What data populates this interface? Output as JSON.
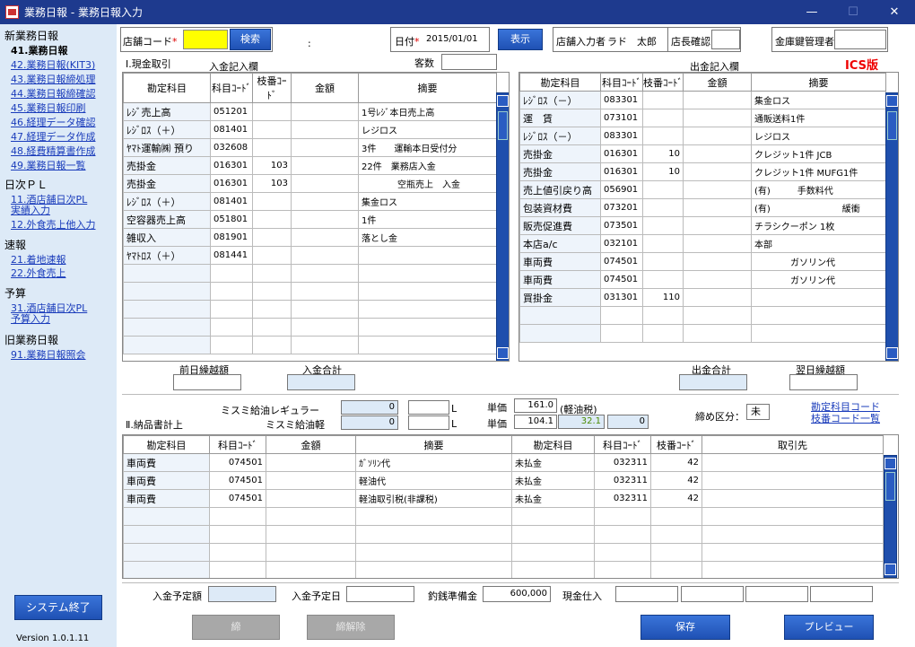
{
  "window": {
    "title": "業務日報 - 業務日報入力",
    "min": "—",
    "max": "☐",
    "close": "✕"
  },
  "sidebar": {
    "sec1": "新業務日報",
    "items1": [
      "41.業務日報",
      "42.業務日報(KIT3)",
      "43.業務日報締処理",
      "44.業務日報締確認",
      "45.業務日報印刷",
      "46.経理データ確認",
      "47.経理データ作成",
      "48.経費精算書作成",
      "49.業務日報一覧"
    ],
    "sec2": "日次ＰＬ",
    "items2": [
      [
        "11.酒店舗日次PL",
        "実績入力"
      ],
      [
        "12.外食売上他入力"
      ]
    ],
    "sec3": "速報",
    "items3": [
      "21.着地速報",
      "22.外食売上"
    ],
    "sec4": "予算",
    "items4": [
      [
        "31.酒店舗日次PL",
        "予算入力"
      ]
    ],
    "sec5": "旧業務日報",
    "items5": [
      "91.業務日報照会"
    ],
    "exit_button": "システム終了",
    "version": "Version  1.0.1.11"
  },
  "header": {
    "store_code_label": "店舗コード",
    "required_mark": "*",
    "store_code_value": "",
    "search_button": "検索",
    "colon": ":",
    "date_label": "日付",
    "date_value": "2015/01/01",
    "show_button": "表示",
    "store_input_label": "店舗入力者",
    "store_input_value": "ラド　太郎",
    "manager_confirm_label": "店長確認",
    "manager_confirm_value": "",
    "safe_key_label": "金庫鍵管理者",
    "safe_key_value": ""
  },
  "section1": {
    "title": "I.現金取引",
    "in_label": "入金記入欄",
    "customers_label": "客数",
    "customers_value": "",
    "out_label": "出金記入欄",
    "ics_label": "ICS版"
  },
  "in_table": {
    "headers": [
      "勘定科目",
      "科目ｺｰﾄﾞ",
      "枝番ｺｰﾄﾞ",
      "金額",
      "摘要"
    ],
    "rows": [
      [
        "ﾚｼﾞ売上高",
        "051201",
        "",
        "",
        "1号ﾚｼﾞ本日売上高"
      ],
      [
        "ﾚｼﾞﾛｽ（＋）",
        "081401",
        "",
        "",
        "レジロス"
      ],
      [
        "ﾔﾏﾄ運輸㈱ 預り",
        "032608",
        "",
        "",
        "3件　　運輸本日受付分"
      ],
      [
        "売掛金",
        "016301",
        "103",
        "",
        "22件　業務店入金"
      ],
      [
        "売掛金",
        "016301",
        "103",
        "",
        "　　　　空瓶売上　入金"
      ],
      [
        "ﾚｼﾞﾛｽ（＋）",
        "081401",
        "",
        "",
        "集金ロス"
      ],
      [
        "空容器売上高",
        "051801",
        "",
        "",
        "1件"
      ],
      [
        "雑収入",
        "081901",
        "",
        "",
        "落とし金"
      ],
      [
        "ﾔﾏﾄﾛｽ（＋）",
        "081441",
        "",
        "",
        ""
      ],
      [
        "",
        "",
        "",
        "",
        ""
      ],
      [
        "",
        "",
        "",
        "",
        ""
      ],
      [
        "",
        "",
        "",
        "",
        ""
      ],
      [
        "",
        "",
        "",
        "",
        ""
      ],
      [
        "",
        "",
        "",
        "",
        ""
      ]
    ]
  },
  "out_table": {
    "headers": [
      "勘定科目",
      "科目ｺｰﾄﾞ",
      "枝番ｺｰﾄﾞ",
      "金額",
      "摘要"
    ],
    "rows": [
      [
        "ﾚｼﾞﾛｽ（－）",
        "083301",
        "",
        "",
        "集金ロス"
      ],
      [
        "運　賃",
        "073101",
        "",
        "",
        "通販送料1件"
      ],
      [
        "ﾚｼﾞﾛｽ（－）",
        "083301",
        "",
        "",
        "レジロス"
      ],
      [
        "売掛金",
        "016301",
        "10",
        "",
        "クレジット1件  JCB"
      ],
      [
        "売掛金",
        "016301",
        "10",
        "",
        "クレジット1件  MUFG1件"
      ],
      [
        "売上値引戻り高",
        "056901",
        "",
        "",
        "(有)　　　手数料代"
      ],
      [
        "包装資材費",
        "073201",
        "",
        "",
        "(有)　　　　　　　　緩衝"
      ],
      [
        "販売促進費",
        "073501",
        "",
        "",
        "チラシクーポン  1枚"
      ],
      [
        "本店a/c",
        "032101",
        "",
        "",
        "本部"
      ],
      [
        "車両費",
        "074501",
        "",
        "",
        "　　　　ガソリン代"
      ],
      [
        "車両費",
        "074501",
        "",
        "",
        "　　　　ガソリン代"
      ],
      [
        "買掛金",
        "031301",
        "110",
        "",
        ""
      ],
      [
        "",
        "",
        "",
        "",
        ""
      ],
      [
        "",
        "",
        "",
        "",
        ""
      ]
    ]
  },
  "totals": {
    "prev_balance": "前日繰越額",
    "in_total": "入金合計",
    "out_total": "出金合計",
    "next_balance": "翌日繰越額"
  },
  "fuel": {
    "regular_label": "ミスミ給油レギュラー",
    "regular_value": "0",
    "light_label": "ミスミ給油軽",
    "light_value": "0",
    "unit_l": "L",
    "price_label": "単価",
    "regular_price": "161.0",
    "light_price": "104.1",
    "light_tax_label": "(軽油税)",
    "light_tax": "32.1",
    "extra_value": "0",
    "closing_label": "締め区分：",
    "closing_value": "未",
    "link1": "勘定科目コード",
    "link2": "枝番コード一覧"
  },
  "section2": {
    "title": "Ⅱ.納品書計上"
  },
  "delivery_table": {
    "headers": [
      "勘定科目",
      "科目ｺｰﾄﾞ",
      "金額",
      "摘要",
      "勘定科目",
      "科目ｺｰﾄﾞ",
      "枝番ｺｰﾄﾞ",
      "取引先"
    ],
    "rows": [
      [
        "車両費",
        "074501",
        "",
        "ｶﾞｿﾘﾝ代",
        "未払金",
        "032311",
        "42",
        ""
      ],
      [
        "車両費",
        "074501",
        "",
        "軽油代",
        "未払金",
        "032311",
        "42",
        ""
      ],
      [
        "車両費",
        "074501",
        "",
        "軽油取引税(非課税)",
        "未払金",
        "032311",
        "42",
        ""
      ],
      [
        "",
        "",
        "",
        "",
        "",
        "",
        "",
        ""
      ],
      [
        "",
        "",
        "",
        "",
        "",
        "",
        "",
        ""
      ],
      [
        "",
        "",
        "",
        "",
        "",
        "",
        "",
        ""
      ],
      [
        "",
        "",
        "",
        "",
        "",
        "",
        "",
        ""
      ]
    ]
  },
  "footer": {
    "scheduled_in_label": "入金予定額",
    "scheduled_date_label": "入金予定日",
    "change_reserve_label": "釣銭準備金",
    "change_reserve_value": "600,000",
    "cash_purchase_label": "現金仕入",
    "close_button": "締",
    "unclose_button": "締解除",
    "save_button": "保存",
    "preview_button": "プレビュー"
  }
}
